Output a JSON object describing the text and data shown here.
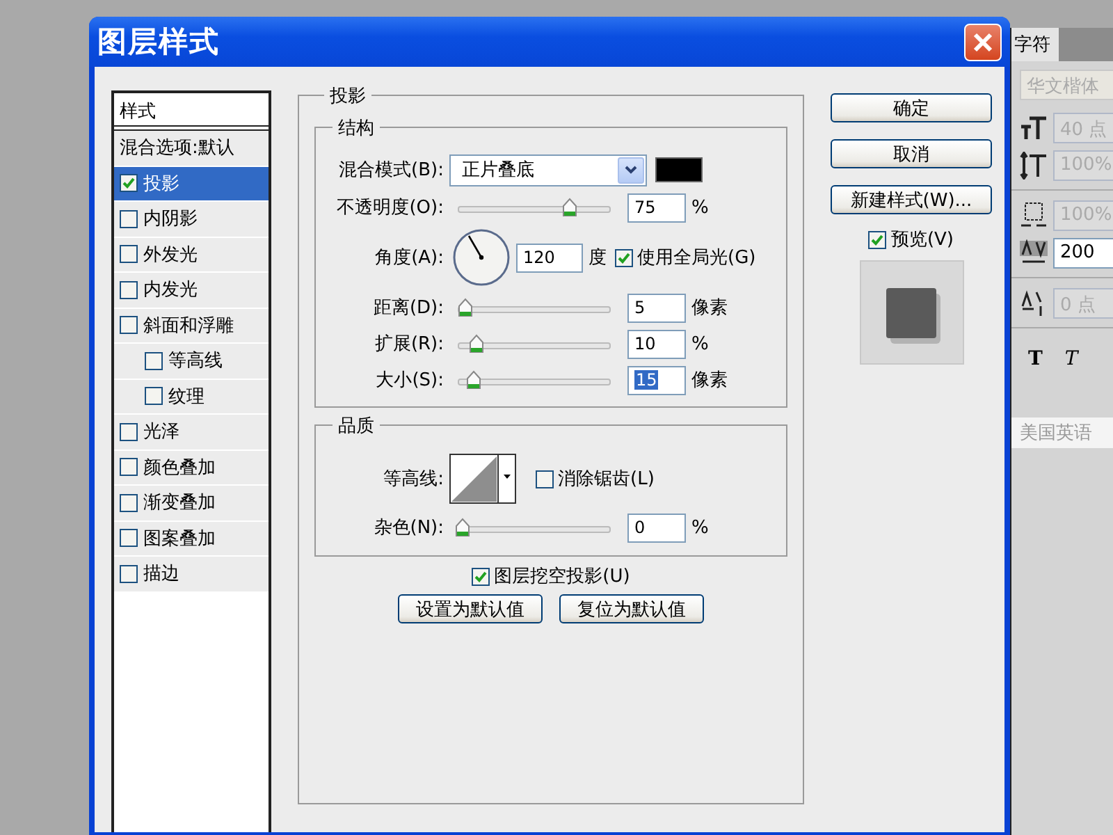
{
  "window": {
    "title": "图层样式"
  },
  "styles_panel": {
    "header": "样式",
    "items": [
      {
        "label": "混合选项:默认",
        "kind": "header",
        "selected": false
      },
      {
        "label": "投影",
        "kind": "check",
        "checked": true,
        "selected": true
      },
      {
        "label": "内阴影",
        "kind": "check",
        "checked": false,
        "selected": false
      },
      {
        "label": "外发光",
        "kind": "check",
        "checked": false,
        "selected": false
      },
      {
        "label": "内发光",
        "kind": "check",
        "checked": false,
        "selected": false
      },
      {
        "label": "斜面和浮雕",
        "kind": "check",
        "checked": false,
        "selected": false,
        "children": [
          {
            "label": "等高线",
            "kind": "check",
            "checked": false,
            "selected": false
          },
          {
            "label": "纹理",
            "kind": "check",
            "checked": false,
            "selected": false
          }
        ]
      },
      {
        "label": "光泽",
        "kind": "check",
        "checked": false,
        "selected": false
      },
      {
        "label": "颜色叠加",
        "kind": "check",
        "checked": false,
        "selected": false
      },
      {
        "label": "渐变叠加",
        "kind": "check",
        "checked": false,
        "selected": false
      },
      {
        "label": "图案叠加",
        "kind": "check",
        "checked": false,
        "selected": false
      },
      {
        "label": "描边",
        "kind": "check",
        "checked": false,
        "selected": false
      }
    ]
  },
  "drop_shadow": {
    "title": "投影",
    "structure": {
      "title": "结构",
      "blend_mode": {
        "label": "混合模式(B):",
        "value": "正片叠底"
      },
      "opacity": {
        "label": "不透明度(O):",
        "level": 0.75,
        "value": "75",
        "unit": "%",
        "highlighted": false
      },
      "angle": {
        "label": "角度(A):",
        "value": "120",
        "unit": "度",
        "global_light": {
          "label": "使用全局光(G)",
          "checked": true
        }
      },
      "distance": {
        "label": "距离(D):",
        "level": 0.02,
        "value": "5",
        "unit": "像素",
        "highlighted": false
      },
      "spread": {
        "label": "扩展(R):",
        "level": 0.1,
        "value": "10",
        "unit": "%",
        "highlighted": false
      },
      "size": {
        "label": "大小(S):",
        "level": 0.08,
        "value": "15",
        "unit": "像素",
        "highlighted": true
      }
    },
    "quality": {
      "title": "品质",
      "contour": {
        "label": "等高线:"
      },
      "anti_alias": {
        "label": "消除锯齿(L)",
        "checked": false
      },
      "noise": {
        "label": "杂色(N):",
        "level": 0,
        "value": "0",
        "unit": "%",
        "highlighted": false
      }
    },
    "knockout": {
      "label": "图层挖空投影(U)",
      "checked": true
    },
    "buttons": [
      "设置为默认值",
      "复位为默认值"
    ]
  },
  "side_buttons": [
    "确定",
    "取消",
    "新建样式(W)..."
  ],
  "preview": {
    "label": "预览(V)",
    "checked": true
  },
  "character_panel": {
    "tab": "字符",
    "font": {
      "value": "华文楷体",
      "disabled": true
    },
    "fields": [
      {
        "kind": "size",
        "value": "40 点",
        "disabled": true
      },
      {
        "kind": "leading",
        "value": "100%",
        "disabled": true
      },
      {
        "kind": "scale",
        "value": "100%",
        "disabled": true
      },
      {
        "kind": "tracking",
        "value": "200",
        "disabled": false
      },
      {
        "kind": "baseline",
        "value": "0 点",
        "disabled": true
      }
    ],
    "style_buttons": [
      {
        "label": "T",
        "kind": "bold"
      },
      {
        "label": "T",
        "kind": "italic"
      }
    ],
    "language": {
      "value": "美国英语",
      "disabled": true
    }
  }
}
